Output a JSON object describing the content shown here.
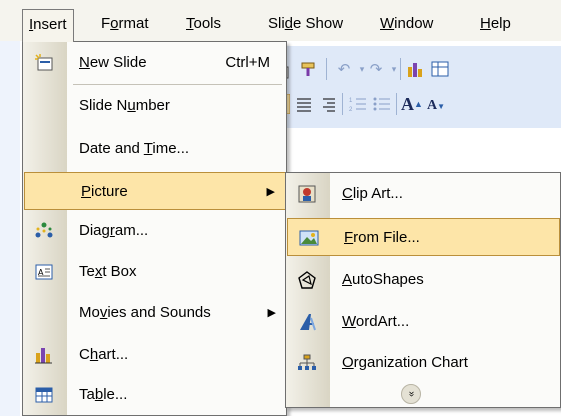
{
  "menubar": {
    "items": [
      {
        "label": "Insert",
        "ul": "I",
        "rest": "nsert"
      },
      {
        "label": "Format",
        "pre": "F",
        "ul": "o",
        "rest": "rmat"
      },
      {
        "label": "Tools",
        "ul": "T",
        "rest": "ools"
      },
      {
        "label": "Slide Show",
        "pre": "Sli",
        "ul": "d",
        "rest": "e Show"
      },
      {
        "label": "Window",
        "ul": "W",
        "rest": "indow"
      },
      {
        "label": "Help",
        "ul": "H",
        "rest": "elp"
      }
    ]
  },
  "insert_menu": {
    "items": [
      {
        "label": "New Slide",
        "ul": "N",
        "rest": "ew Slide",
        "shortcut": "Ctrl+M",
        "icon": "new-slide-icon"
      },
      {
        "label": "Slide Number",
        "pre": "Slide N",
        "ul": "u",
        "rest": "mber"
      },
      {
        "label": "Date and Time...",
        "pre": "Date and ",
        "ul": "T",
        "rest": "ime..."
      },
      {
        "label": "Picture",
        "ul": "P",
        "rest": "icture",
        "submenu": true
      },
      {
        "label": "Diagram...",
        "pre": "Diag",
        "ul": "r",
        "rest": "am...",
        "icon": "diagram-icon"
      },
      {
        "label": "Text Box",
        "pre": "Te",
        "ul": "x",
        "rest": "t Box",
        "icon": "text-box-icon"
      },
      {
        "label": "Movies and Sounds",
        "pre": "Mo",
        "ul": "v",
        "rest": "ies and Sounds",
        "submenu": true
      },
      {
        "label": "Chart...",
        "pre": "C",
        "ul": "h",
        "rest": "art...",
        "icon": "chart-icon"
      },
      {
        "label": "Table...",
        "pre": "Ta",
        "ul": "b",
        "rest": "le...",
        "icon": "table-icon"
      }
    ]
  },
  "picture_submenu": {
    "items": [
      {
        "label": "Clip Art...",
        "ul": "C",
        "rest": "lip Art...",
        "icon": "clip-art-icon"
      },
      {
        "label": "From File...",
        "ul": "F",
        "rest": "rom File...",
        "icon": "from-file-icon"
      },
      {
        "label": "AutoShapes",
        "ul": "A",
        "rest": "utoShapes",
        "icon": "autoshapes-icon"
      },
      {
        "label": "WordArt...",
        "ul": "W",
        "rest": "ordArt...",
        "icon": "wordart-icon"
      },
      {
        "label": "Organization Chart",
        "ul": "O",
        "rest": "rganization Chart",
        "icon": "org-chart-icon"
      }
    ],
    "expand_icon": "expand-chevron-icon"
  },
  "colors": {
    "highlight": "#fde5a8",
    "highlight_border": "#ba8f3b",
    "menu_bg": "#fbfbf9",
    "toolbar_bg": "#dfe9f8"
  }
}
